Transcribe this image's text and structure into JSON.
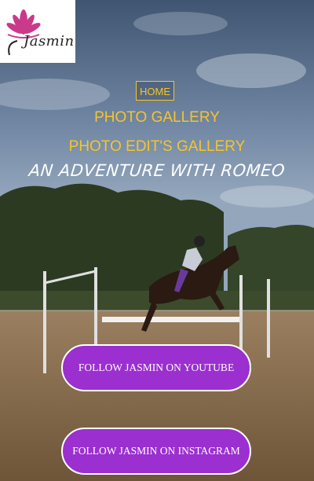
{
  "logo": {
    "text": "Jasmin",
    "icon": "lotus-icon"
  },
  "nav": {
    "home_label": "HOME",
    "photo_gallery_label": "PHOTO GALLERY",
    "photo_edits_label": "PHOTO EDIT'S GALLERY"
  },
  "hero": {
    "title": "AN ADVENTURE WITH ROMEO",
    "image": "horse-jumping-photo"
  },
  "buttons": {
    "youtube_label": "FOLLOW JASMIN ON YOUTUBE",
    "instagram_label": "FOLLOW JASMIN ON INSTAGRAM"
  },
  "colors": {
    "accent": "#f5c52a",
    "button_bg": "#9b2fd0",
    "sky": "#5a6f88",
    "ground": "#8a7050"
  }
}
